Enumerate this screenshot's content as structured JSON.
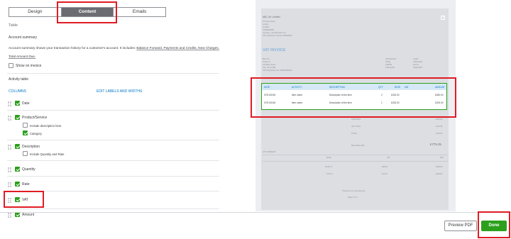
{
  "tabs": [
    {
      "label": "Design"
    },
    {
      "label": "Content"
    },
    {
      "label": "Emails"
    }
  ],
  "section_title": "Table",
  "account_summary": {
    "heading": "Account summary",
    "description_prefix": "Account summary shows your transaction history for a customer's account. It includes: ",
    "description_links": "Balance Forward, Payments and Credits, New Charges,",
    "description_line2": "Total Amount Due.",
    "show_on_invoice": "Show on invoice"
  },
  "activity_table": {
    "heading": "Activity table",
    "columns_label": "COLUMNS",
    "edit_link": "EDIT LABELS AND WIDTHS",
    "columns": [
      {
        "label": "Date",
        "checked": true
      },
      {
        "label": "Product/Service",
        "checked": true
      },
      {
        "label": "Description",
        "checked": true
      },
      {
        "label": "Quantity",
        "checked": true
      },
      {
        "label": "Rate",
        "checked": true
      },
      {
        "label": "VAT",
        "checked": true
      },
      {
        "label": "Amount",
        "checked": true
      }
    ],
    "product_options": [
      {
        "label": "Include description here",
        "checked": false
      },
      {
        "label": "Category",
        "checked": true
      }
    ],
    "description_options": [
      {
        "label": "Include Quantity and Rate",
        "checked": false
      }
    ]
  },
  "preview": {
    "company_name": "ABC UK Limited",
    "company_lines": [
      "10 Some Road",
      "London",
      "A1 2BC",
      "07000000000",
      "company_name@mail.co.uk",
      "VAT registration number 000000000"
    ],
    "title": "VAT INVOICE",
    "bill_to_label": "BILL TO",
    "bill_to_lines": [
      "Smith Co.",
      "123 Main Street",
      "City, Gb A1 2B3",
      "VAT Registration No. GB000000000"
    ],
    "meta": [
      {
        "label": "INVOICE NO.",
        "value": "12345"
      },
      {
        "label": "DATE",
        "value": "01/01/2018"
      },
      {
        "label": "TERMS",
        "value": "Net 30"
      },
      {
        "label": "DUE DATE",
        "value": "31/01/2018"
      }
    ],
    "table_headers": [
      "DATE",
      "ACTIVITY",
      "DESCRIPTION",
      "QTY",
      "RATE",
      "VAT",
      "AMOUNT"
    ],
    "table_rows": [
      [
        "07/01/2018",
        "Item name",
        "Description of the item",
        "2",
        "£225.00",
        "",
        "£450.00"
      ],
      [
        "07/01/2018",
        "Item name",
        "Description of the item",
        "1",
        "£225.00",
        "",
        "£225.00"
      ]
    ],
    "totals": [
      {
        "label": "SUBTOTAL",
        "value": "£675.00"
      },
      {
        "label": "VAT TOTAL",
        "value": "£101.25"
      },
      {
        "label": "TOTAL",
        "value": "£776.25"
      }
    ],
    "balance_due_label": "BALANCE DUE",
    "balance_due_value": "£776.25",
    "vat_summary_label": "VAT SUMMARY",
    "vat_headers": [
      "RATE",
      "VAT",
      "NET"
    ],
    "vat_rows": [
      [
        "20.0% S",
        "£90.00",
        "£450.00"
      ],
      [
        "5.0% R",
        "£11.25",
        "£225.00"
      ]
    ],
    "footer_line1": "Thank you for your business",
    "footer_line2": "Page 1 of 1"
  },
  "footer": {
    "preview_pdf": "Preview PDF",
    "done": "Done"
  },
  "colors": {
    "accent_green": "#2ca01c",
    "link_blue": "#0077c5",
    "highlight_red": "#e01b24"
  }
}
